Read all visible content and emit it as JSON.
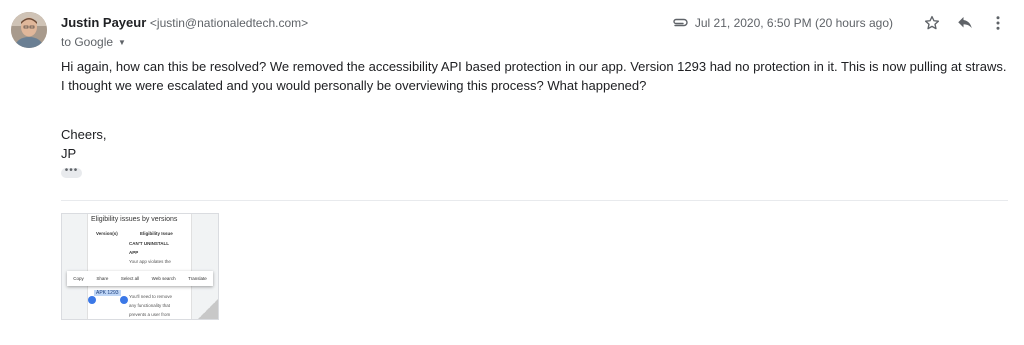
{
  "message": {
    "sender_name": "Justin Payeur",
    "sender_email": "<justin@nationaledtech.com>",
    "to_label": "to Google",
    "date": "Jul 21, 2020, 6:50 PM (20 hours ago)",
    "body": "Hi again, how can this be resolved? We removed the accessibility API based protection in our app. Version 1293 had no protection in it. This is now pulling at straws. I thought we were escalated and you would personally be overviewing this process? What happened?",
    "signoff": "Cheers,",
    "signature": "JP",
    "trimmed_label": "•••"
  },
  "attachment": {
    "title": "Eligibility issues by versions",
    "col_version": "Version(s)",
    "col_issue": "Eligibility Issue",
    "issue_line1": "CAN'T UNINSTALL",
    "issue_line2": "APP",
    "issue_line3": "Your app violates the",
    "menu": [
      "Copy",
      "Share",
      "Select all",
      "Web search",
      "Translate"
    ],
    "apk": "APK 1293",
    "detail_line1": "You'll need to remove",
    "detail_line2": "any functionality that",
    "detail_line3": "prevents a user from"
  },
  "colors": {
    "secondary_text": "#5f6368",
    "primary_text": "#202124",
    "selection_handle": "#3b78e7"
  },
  "icons": [
    "avatar",
    "paperclip-icon",
    "star-icon",
    "reply-icon",
    "more-vert-icon",
    "caret-down-icon"
  ]
}
